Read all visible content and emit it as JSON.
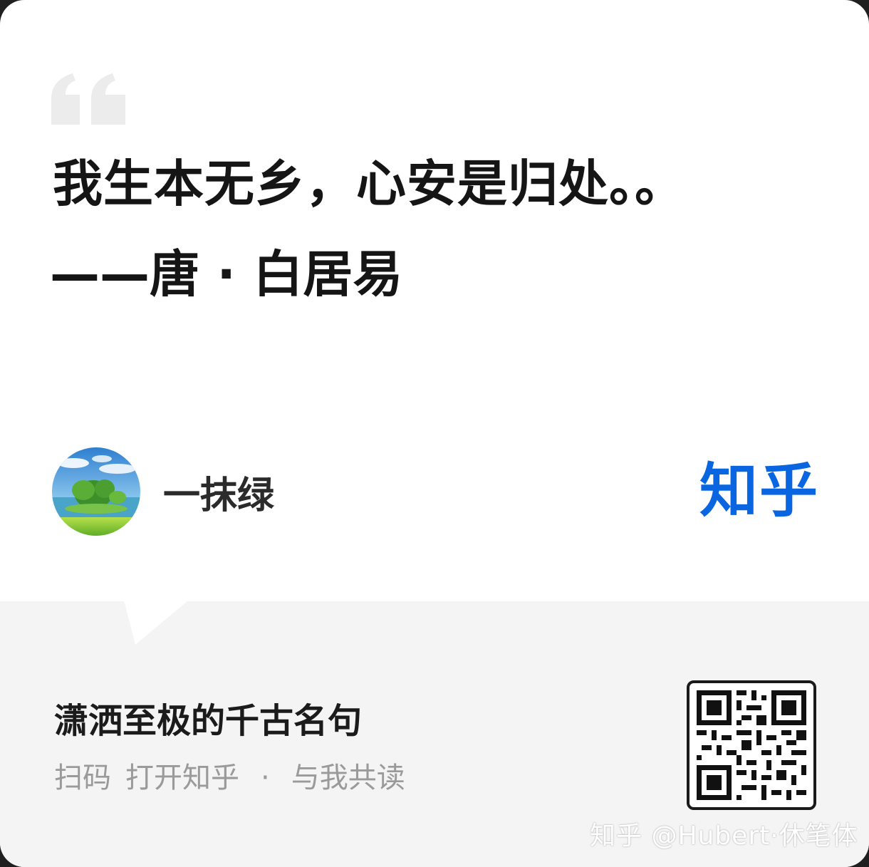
{
  "quote": {
    "text": "我生本无乡，心安是归处。。",
    "attribution": "——唐 · 白居易"
  },
  "author": {
    "name": "一抹绿",
    "avatar": "landscape-avatar"
  },
  "brand": {
    "logo_text": "知乎",
    "color": "#0a66e0"
  },
  "footer": {
    "collection_title": "潇洒至极的千古名句",
    "cta_scan": "扫码",
    "cta_open": "打开知乎",
    "cta_separator": "·",
    "cta_read": "与我共读",
    "qr_code": "qr-code-icon"
  },
  "watermark": {
    "text": "知乎 @Hubert·休笔体"
  }
}
